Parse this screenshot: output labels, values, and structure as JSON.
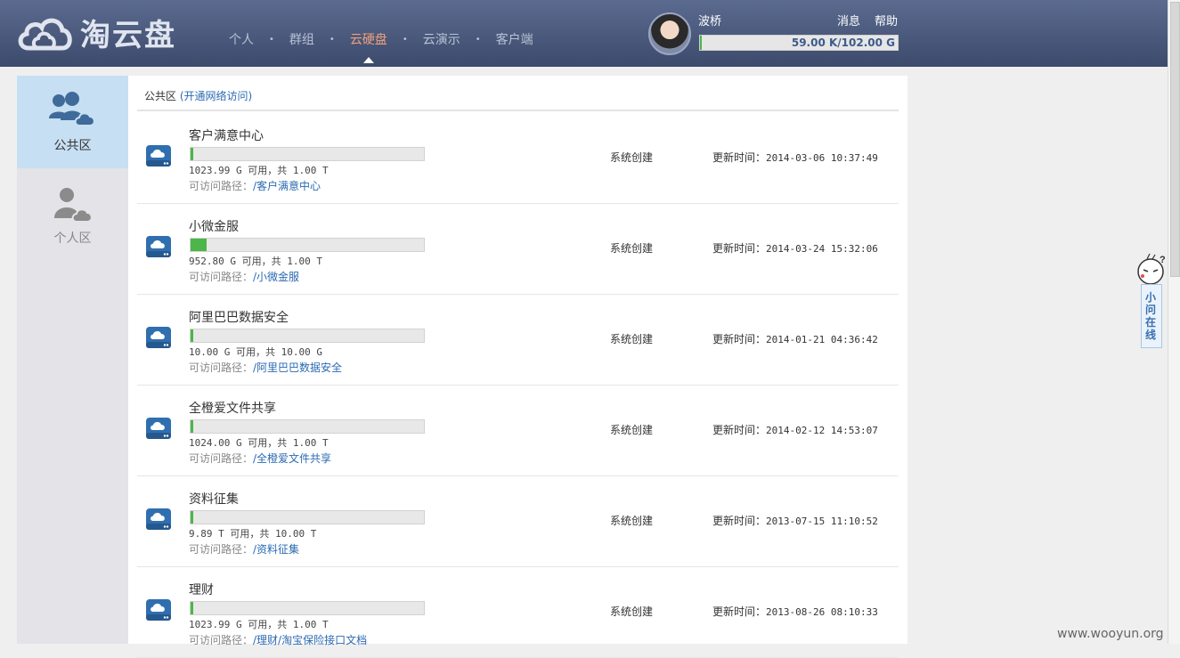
{
  "header": {
    "logo_text": "淘云盘",
    "nav": [
      "个人",
      "群组",
      "云硬盘",
      "云演示",
      "客户端"
    ],
    "active_nav": "云硬盘",
    "username": "波桥",
    "messages_label": "消息",
    "help_label": "帮助",
    "quota_text": "59.00 K/102.00 G",
    "quota_used_fraction": 0.005
  },
  "sidebar": {
    "public_label": "公共区",
    "personal_label": "个人区"
  },
  "breadcrumb": {
    "current": "公共区",
    "link": "(开通网络访问)"
  },
  "path_label": "可访问路径：",
  "updated_label": "更新时间：",
  "rows": [
    {
      "name": "客户满意中心",
      "capacity": "1023.99 G 可用，共 1.00 T",
      "path": "/客户满意中心",
      "creator": "系统创建",
      "time": "2014-03-06 10:37:49",
      "used_fraction": 0.01
    },
    {
      "name": "小微金服",
      "capacity": "952.80 G 可用，共 1.00 T",
      "path": "/小微金服",
      "creator": "系统创建",
      "time": "2014-03-24 15:32:06",
      "used_fraction": 0.07
    },
    {
      "name": "阿里巴巴数据安全",
      "capacity": "10.00 G 可用，共 10.00 G",
      "path": "/阿里巴巴数据安全",
      "creator": "系统创建",
      "time": "2014-01-21 04:36:42",
      "used_fraction": 0.01
    },
    {
      "name": "全橙爱文件共享",
      "capacity": "1024.00 G 可用，共 1.00 T",
      "path": "/全橙爱文件共享",
      "creator": "系统创建",
      "time": "2014-02-12 14:53:07",
      "used_fraction": 0.01
    },
    {
      "name": "资料征集",
      "capacity": "9.89 T 可用，共 10.00 T",
      "path": "/资料征集",
      "creator": "系统创建",
      "time": "2013-07-15 11:10:52",
      "used_fraction": 0.011
    },
    {
      "name": "理财",
      "capacity": "1023.99 G 可用，共 1.00 T",
      "path": "/理财/淘宝保险接口文档",
      "creator": "系统创建",
      "time": "2013-08-26 08:10:33",
      "used_fraction": 0.01
    }
  ],
  "helper": {
    "label": "小问在线"
  },
  "watermark": "www.wooyun.org"
}
